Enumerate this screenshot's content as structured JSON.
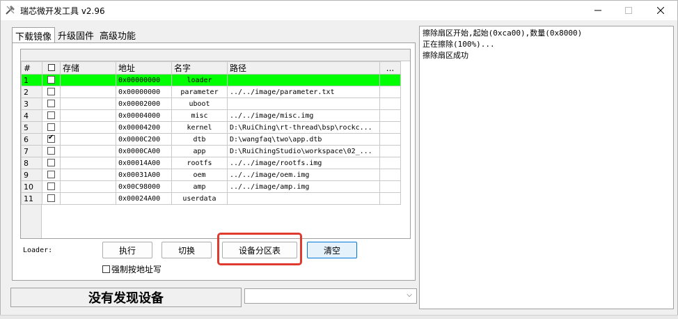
{
  "window": {
    "title": "瑞芯微开发工具 v2.96",
    "controls": {
      "minimize": "—",
      "maximize": "☐",
      "close": "✕"
    }
  },
  "tabs": [
    {
      "label": "下载镜像",
      "active": true
    },
    {
      "label": "升级固件",
      "active": false
    },
    {
      "label": "高级功能",
      "active": false
    }
  ],
  "grid": {
    "columns": [
      "#",
      "",
      "存储",
      "地址",
      "名字",
      "路径",
      "..."
    ],
    "rows": [
      {
        "num": "1",
        "checked": false,
        "storage": "",
        "address": "0x00000000",
        "name": "loader",
        "path": "",
        "highlight": true
      },
      {
        "num": "2",
        "checked": false,
        "storage": "",
        "address": "0x00000000",
        "name": "parameter",
        "path": "../../image/parameter.txt",
        "highlight": false
      },
      {
        "num": "3",
        "checked": false,
        "storage": "",
        "address": "0x00002000",
        "name": "uboot",
        "path": "",
        "highlight": false
      },
      {
        "num": "4",
        "checked": false,
        "storage": "",
        "address": "0x00004000",
        "name": "misc",
        "path": "../../image/misc.img",
        "highlight": false
      },
      {
        "num": "5",
        "checked": false,
        "storage": "",
        "address": "0x00004200",
        "name": "kernel",
        "path": "D:\\RuiChing\\rt-thread\\bsp\\rockc...",
        "highlight": false
      },
      {
        "num": "6",
        "checked": true,
        "storage": "",
        "address": "0x0000C200",
        "name": "dtb",
        "path": "D:\\wangfaq\\two\\app.dtb",
        "highlight": false
      },
      {
        "num": "7",
        "checked": false,
        "storage": "",
        "address": "0x0000CA00",
        "name": "app",
        "path": "D:\\RuiChingStudio\\workspace\\02_...",
        "highlight": false
      },
      {
        "num": "8",
        "checked": false,
        "storage": "",
        "address": "0x00014A00",
        "name": "rootfs",
        "path": "../../image/rootfs.img",
        "highlight": false
      },
      {
        "num": "9",
        "checked": false,
        "storage": "",
        "address": "0x00031A00",
        "name": "oem",
        "path": "../../image/oem.img",
        "highlight": false
      },
      {
        "num": "10",
        "checked": false,
        "storage": "",
        "address": "0x00C98000",
        "name": "amp",
        "path": "../../image/amp.img",
        "highlight": false
      },
      {
        "num": "11",
        "checked": false,
        "storage": "",
        "address": "0x00024A00",
        "name": "userdata",
        "path": "",
        "highlight": false
      }
    ]
  },
  "actions": {
    "loader_label": "Loader:",
    "execute": "执行",
    "switch": "切换",
    "partition_table": "设备分区表",
    "clear": "清空",
    "force_by_address": "强制按地址写"
  },
  "status": {
    "device_text": "没有发现设备",
    "device_select_value": ""
  },
  "log": {
    "lines": [
      "擦除扇区开始,起始(0xca00),数量(0x8000)",
      "正在擦除(100%)...",
      "擦除扇区成功"
    ]
  },
  "colors": {
    "highlight_row": "#00ff00",
    "annotation_box": "#e03a2f",
    "focused_button": "#0078d7"
  }
}
